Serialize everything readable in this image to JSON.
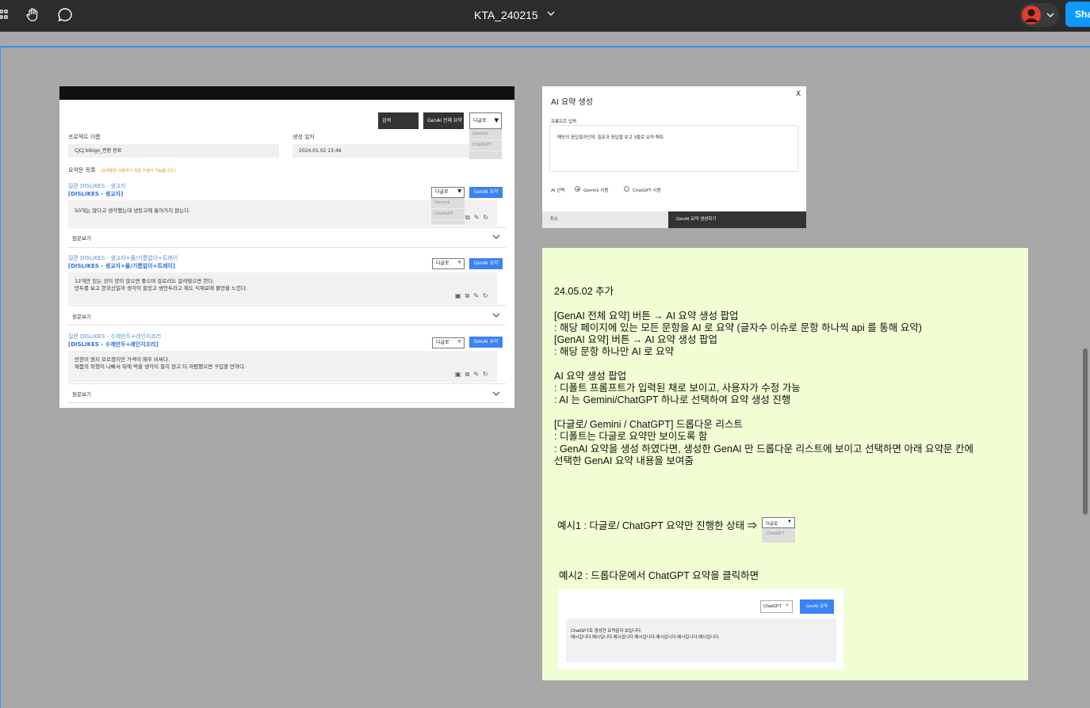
{
  "topbar": {
    "doc_title": "KTA_240215",
    "share_label": "Sha"
  },
  "frame1": {
    "search_btn": "검색",
    "genai_all_btn": "GenAI 전체 요약",
    "top_dropdown": {
      "selected": "다글로",
      "options": [
        "Gemini",
        "ChatGPT"
      ]
    },
    "project_label": "프로젝트 이름",
    "project_value": "CJCJ bibigo_변환 완료",
    "created_label": "생성 일자",
    "created_value": "2024.01.02 15:46",
    "summary_list_label": "요약문 목록",
    "summary_list_note": "(요약문은 사용자가 직접 수정이 가능합니다.)",
    "view_original": "원문보기",
    "items": [
      {
        "question": "질문 DISLIKES - 생교자",
        "bold": "[DISLIKES - 생교자]",
        "dropdown": "다글로",
        "dropdown_options": [
          "Gemini",
          "ChatGPT"
        ],
        "genai_btn": "GenAI 요약",
        "text_1": "50개는 많다고 생각했는데 냉동고에 통어가지 않는다.",
        "text_2": ""
      },
      {
        "question": "질문 DISLIKES - 생교자+물/기름없이+트레이",
        "bold": "[DISLIKES - 생교자+물/기름없이+트레이]",
        "dropdown": "다글로",
        "genai_btn": "GenAI 요약",
        "text_1": "12개만 있는 것이 양이 많으면 좋으며 칼로리도 알려줬으면 한다.",
        "text_2": "만두를 보고 한국산일까 생각이 들었고 생만두라고 해도 식재료에 불안을 느낀다."
      },
      {
        "question": "질문 DISLIKES - 수제만두+레인지조리",
        "bold": "[DISLIKES - 수제만두+레인지조리]",
        "dropdown": "다글로",
        "genai_btn": "GenAI 요약",
        "text_1": "반찬이 뭔지 모르겠지만 가격이 매우 비싸다.",
        "text_2": "제품의 외형이 나빠서 뒤에 먹을 생각이 들지 않고 더 저렴했으면 구입할 만하다."
      }
    ]
  },
  "modal": {
    "title": "AI 요약 생성",
    "close": "X",
    "prompt_label": "프롬프트 입력",
    "prompt_text": "해당의 응답결과인데, 질문과 응답을 보고 3줄로 요약 해줘",
    "ai_label": "AI 선택",
    "opt_gemini": "Gemini 사용",
    "opt_chatgpt": "ChatGPT 사용",
    "cancel": "취소",
    "generate": "GenAI 요약 생성하기"
  },
  "note": {
    "lines": [
      "24.05.02 추가",
      "[GenAI 전체 요약] 버튼 → AI 요약 생성 팝업",
      ": 해당 페이지에 있는 모든 문항을 AI 로 요약 (글자수 이슈로 문항 하나씩 api 를 통해 요약)",
      "[GenAI 요약] 버튼 → AI 요약 생성 팝업",
      ": 해당 문항 하나만 AI 로 요약",
      "AI 요약 생성 팝업",
      ": 디폴트 프롬프트가 입력된 채로 보이고, 사용자가 수정 가능",
      ": AI 는 Gemini/ChatGPT 하나로 선택하여 요약 생성 진행",
      "[다글로/ Gemini / ChatGPT] 드롭다운 리스트",
      ": 디폴트는 다글로 요약만 보이도록 함",
      ": GenAI 요약을 생성 하였다면, 생성한 GenAI 만 드롭다운 리스트에 보이고 선택하면 아래 요약문 칸에",
      "선택한 GenAI 요약 내용을 보여줌"
    ],
    "example1": "예시1 : 다글로/ ChatGPT 요약만 진행한 상태 ⇒",
    "example1_dd": "다글로",
    "example1_opt": "ChatGPT",
    "example2": "예시2 : 드롭다운에서 ChatGPT 요약을 클릭하면",
    "example2_dd": "ChatGPT",
    "example2_btn": "GenAI 요약",
    "example2_text_1": "ChatGPT로 생성한 요약문이 보입니다.",
    "example2_text_2": "예시입니다.예시입니다.예시입니다.예시입니다.예시입니다.예시입니다.예시입니다."
  }
}
